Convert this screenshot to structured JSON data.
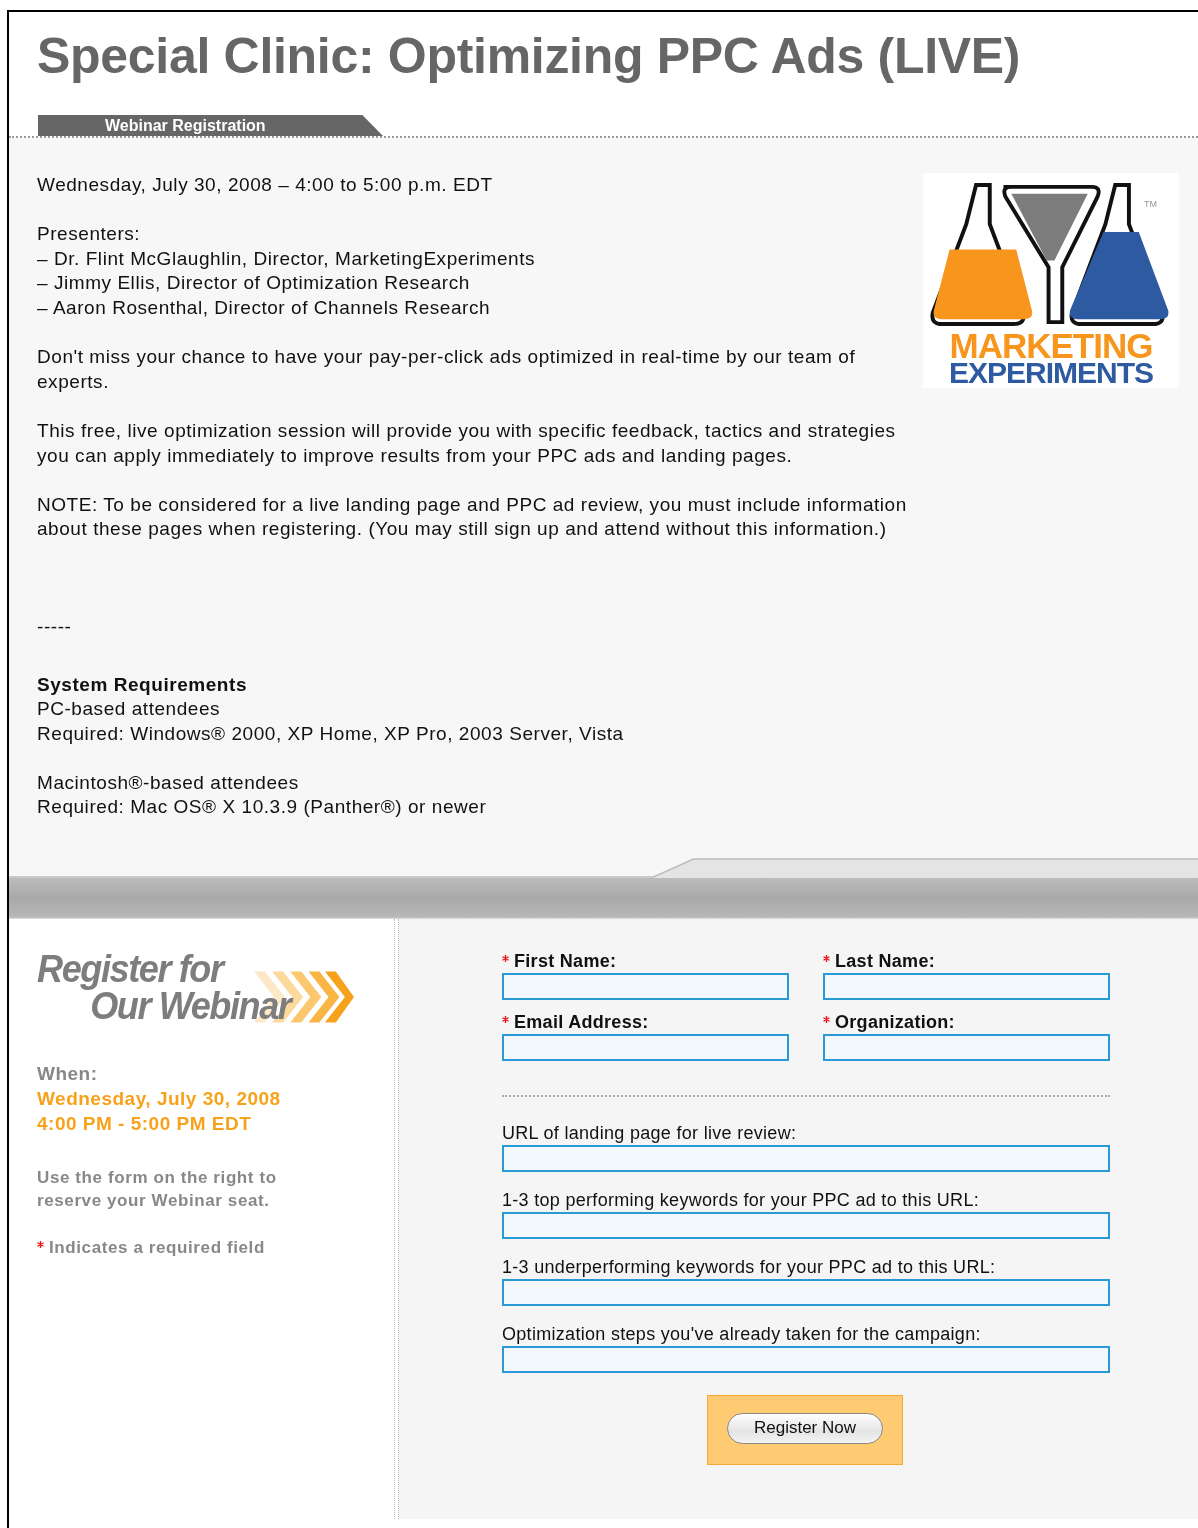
{
  "title": "Special Clinic: Optimizing PPC Ads (LIVE)",
  "tab": "Webinar Registration",
  "event": {
    "date_line": "Wednesday, July 30, 2008 – 4:00 to 5:00 p.m. EDT",
    "presenters_heading": "Presenters:",
    "presenters": [
      "– Dr. Flint McGlaughlin, Director, MarketingExperiments",
      "– Jimmy Ellis, Director of Optimization Research",
      "– Aaron Rosenthal, Director of Channels Research"
    ],
    "paragraphs": [
      "Don't miss your chance to have your pay-per-click ads optimized in real-time by our team of experts.",
      "This free, live optimization session will provide you with specific feedback, tactics and strategies you can apply immediately to improve results from your PPC ads and landing pages.",
      "NOTE: To be considered for a live landing page and PPC ad review, you must include information about these pages when registering. (You may still sign up and attend without this information.)"
    ],
    "separator": "-----",
    "requirements_heading": "System Requirements",
    "requirement_groups": [
      {
        "lines": [
          "PC-based attendees",
          "Required: Windows® 2000, XP Home, XP Pro, 2003 Server, Vista"
        ]
      },
      {
        "lines": [
          "Macintosh®-based attendees",
          "Required: Mac OS® X 10.3.9 (Panther®) or newer"
        ]
      }
    ]
  },
  "logo": {
    "line_1": "MARKETING",
    "line_2": "EXPERIMENTS",
    "trademark": "TM"
  },
  "sidebar": {
    "heading_line_1": "Register for",
    "heading_line_2": "Our Webinar",
    "when_label": "When:",
    "when_lines": [
      "Wednesday, July 30, 2008",
      "4:00 PM - 5:00 PM EDT"
    ],
    "instructions": "Use the form on the right to reserve your Webinar seat.",
    "required_note": "Indicates a required field"
  },
  "form": {
    "fields": [
      {
        "label": "First Name:",
        "required": true,
        "kind": "half"
      },
      {
        "label": "Last Name:",
        "required": true,
        "kind": "half"
      },
      {
        "label": "Email Address:",
        "required": true,
        "kind": "half"
      },
      {
        "label": "Organization:",
        "required": true,
        "kind": "half"
      },
      {
        "label": "URL of landing page for live review:",
        "required": false,
        "kind": "full"
      },
      {
        "label": "1-3 top performing keywords for your PPC ad to this URL:",
        "required": false,
        "kind": "full"
      },
      {
        "label": "1-3 underperforming keywords for your PPC ad to this URL:",
        "required": false,
        "kind": "full"
      },
      {
        "label": "Optimization steps you've already taken for the campaign:",
        "required": false,
        "kind": "full"
      }
    ],
    "submit": "Register Now"
  }
}
